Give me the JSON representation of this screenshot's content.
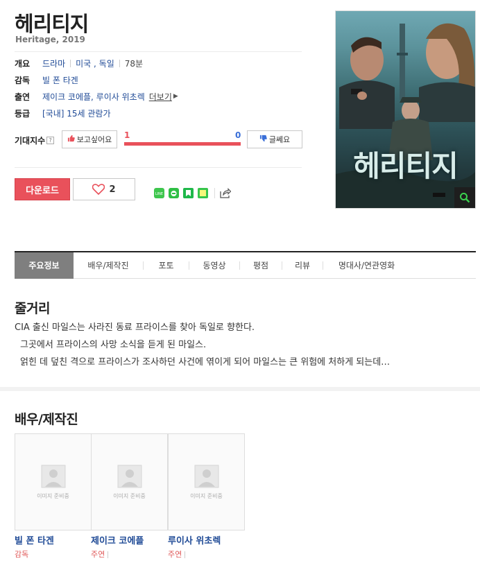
{
  "movie": {
    "title": "헤리티지",
    "subtitle": "Heritage, 2019",
    "info": {
      "overview_label": "개요",
      "genre": "드라마",
      "country": "미국 , 독일",
      "runtime": "78분",
      "director_label": "감독",
      "director": "빌 폰 타겐",
      "cast_label": "출연",
      "cast": "제이크 코에플, 루이사 위초렉",
      "more_label": "더보기",
      "rating_label": "등급",
      "rating": "[국내] 15세 관람가"
    }
  },
  "expectation": {
    "label": "기대지수",
    "help_icon": "?",
    "want_label": "보고싶어요",
    "want_count": "1",
    "nah_label": "글쎄요",
    "nah_count": "0",
    "want_fraction": 1.0,
    "want_color": "#e9515b",
    "nah_color": "#3a6fd8"
  },
  "actions": {
    "download_label": "다운로드",
    "like_count": "2",
    "share_icons": [
      "line-share-icon",
      "band-share-icon",
      "bookmark-share-icon",
      "note-share-icon",
      "share-link-icon"
    ]
  },
  "poster": {
    "title_text": "헤리티지"
  },
  "tabs": [
    "주요정보",
    "배우/제작진",
    "포토",
    "동영상",
    "평점",
    "리뷰",
    "명대사/연관영화"
  ],
  "synopsis": {
    "title": "줄거리",
    "lines": [
      "CIA 출신 마일스는 사라진 동료 프라이스를 찾아 독일로 향한다.",
      "그곳에서 프라이스의 사망 소식을 듣게 된 마일스.",
      "얽힌 데 덮친 격으로 프라이스가 조사하던 사건에 엮이게 되어 마일스는 큰 위험에 처하게 되는데…"
    ]
  },
  "crew": {
    "title": "배우/제작진",
    "placeholder_text": "이미지 준비중",
    "people": [
      {
        "name": "빌 폰 타겐",
        "role": "감독"
      },
      {
        "name": "제이크 코에플",
        "role": "주연"
      },
      {
        "name": "루이사 위초렉",
        "role": "주연"
      }
    ]
  }
}
